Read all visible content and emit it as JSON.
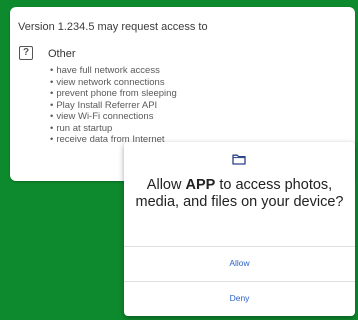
{
  "permissions": {
    "version_text": "Version 1.234.5",
    "request_text": "may request access to",
    "category": {
      "icon": "unknown-permission-icon",
      "title": "Other",
      "items": [
        "have full network access",
        "view network connections",
        "prevent phone from sleeping",
        "Play Install Referrer API",
        "view Wi-Fi connections",
        "run at startup",
        "receive data from Internet"
      ]
    }
  },
  "dialog": {
    "icon": "folder-icon",
    "title_prefix": "Allow",
    "app_name": "APP",
    "title_suffix": "to access photos, media, and files on your device?",
    "allow_label": "Allow",
    "deny_label": "Deny",
    "accent_color": "#2a62c9"
  },
  "colors": {
    "background": "#0e8a2e"
  }
}
